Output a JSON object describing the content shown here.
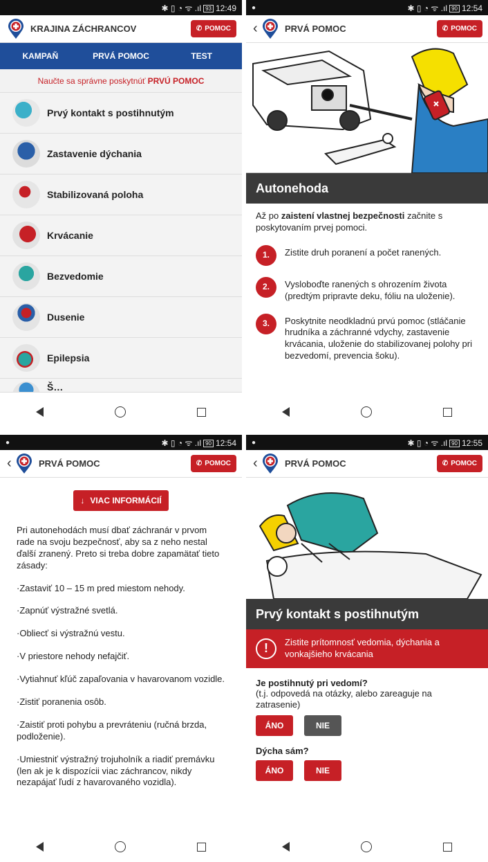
{
  "colors": {
    "accent": "#c62026",
    "tabbar": "#1f4e9a"
  },
  "p1": {
    "status": {
      "left": "",
      "right": "12:49",
      "battery": "93"
    },
    "app_title": "KRAJINA ZÁCHRANCOV",
    "pomoc_label": "POMOC",
    "tabs": [
      "KAMPAŇ",
      "PRVÁ POMOC",
      "TEST"
    ],
    "intro_pre": "Naučte sa správne poskytnúť",
    "intro_bold": "PRVÚ POMOC",
    "items": [
      {
        "label": "Prvý kontakt s postihnutým",
        "icon": "first-contact-thumbnail"
      },
      {
        "label": "Zastavenie dýchania",
        "icon": "breathing-stop-thumbnail"
      },
      {
        "label": "Stabilizovaná poloha",
        "icon": "recovery-position-thumbnail"
      },
      {
        "label": "Krvácanie",
        "icon": "bleeding-thumbnail"
      },
      {
        "label": "Bezvedomie",
        "icon": "unconsciousness-thumbnail"
      },
      {
        "label": "Dusenie",
        "icon": "choking-thumbnail"
      },
      {
        "label": "Epilepsia",
        "icon": "epilepsy-thumbnail"
      },
      {
        "label": "Š…",
        "icon": "shock-thumbnail"
      }
    ]
  },
  "p2": {
    "status": {
      "left": "●",
      "right": "12:54",
      "battery": "90"
    },
    "app_title": "PRVÁ POMOC",
    "pomoc_label": "POMOC",
    "hero_title": "Autonehoda",
    "intro_pre": "Až po",
    "intro_bold": "zaistení vlastnej bezpečnosti",
    "intro_post": "začnite s poskytovaním prvej pomoci.",
    "steps": [
      {
        "num": "1.",
        "text": "Zistite druh poranení a počet ranených."
      },
      {
        "num": "2.",
        "text": "Vysloboďte ranených s ohrozením života (predtým pripravte deku, fóliu na uloženie)."
      },
      {
        "num": "3.",
        "text": "Poskytnite neodkladnú prvú pomoc (stláčanie hrudníka a záchranné vdychy, zastavenie krvácania, uloženie do stabilizovanej polohy pri bezvedomí, prevencia šoku)."
      }
    ]
  },
  "p3": {
    "status": {
      "left": "●",
      "right": "12:54",
      "battery": "90"
    },
    "app_title": "PRVÁ POMOC",
    "pomoc_label": "POMOC",
    "more_label": "VIAC INFORMÁCIÍ",
    "paragraphs": [
      "Pri autonehodách musí dbať záchranár v prvom rade na svoju bezpečnosť, aby sa z neho nestal ďalší zranený. Preto si treba dobre zapamätať tieto zásady:",
      "·Zastaviť 10 – 15 m pred miestom nehody.",
      "·Zapnúť výstražné svetlá.",
      "·Obliecť si výstražnú vestu.",
      "·V priestore nehody nefajčiť.",
      "·Vytiahnuť kľúč zapaľovania v havarovanom vozidle.",
      "·Zistiť poranenia osôb.",
      "·Zaistiť proti pohybu a prevráteniu (ručná brzda, podloženie).",
      "·Umiestniť výstražný trojuholník a riadiť premávku (len ak je k dispozícii viac záchrancov, nikdy nezapájať ľudí z havarovaného vozidla)."
    ]
  },
  "p4": {
    "status": {
      "left": "●",
      "right": "12:55",
      "battery": "90"
    },
    "app_title": "PRVÁ POMOC",
    "pomoc_label": "POMOC",
    "hero_title": "Prvý kontakt s postihnutým",
    "alert_text": "Zistite prítomnosť vedomia, dýchania a vonkajšieho krvácania",
    "q1": {
      "title": "Je postihnutý pri vedomí?",
      "sub": "(t.j. odpovedá na otázky, alebo zareaguje na zatrasenie)",
      "yes": "ÁNO",
      "no": "NIE"
    },
    "q2": {
      "title": "Dýcha sám?",
      "yes": "ÁNO",
      "no": "NIE"
    }
  }
}
